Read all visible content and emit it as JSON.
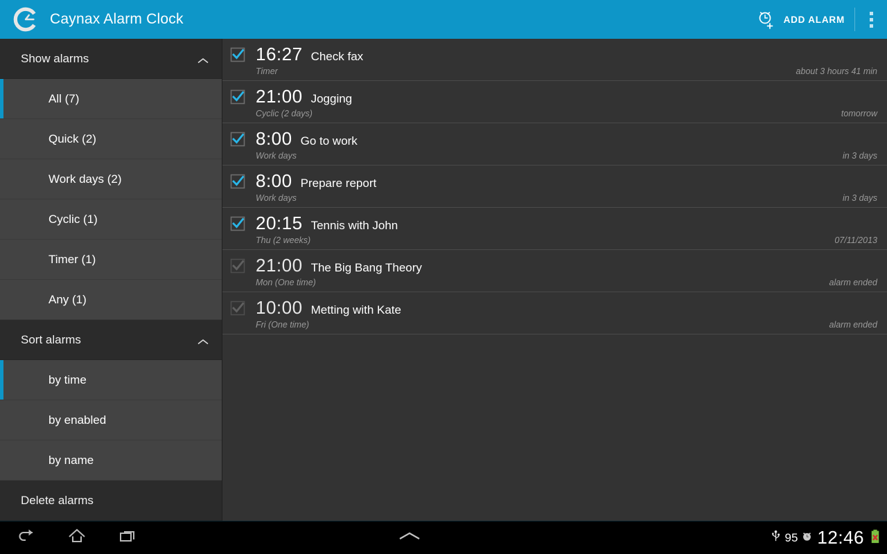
{
  "app": {
    "title": "Caynax Alarm Clock",
    "logo_icon": "caynax-c-clock-logo",
    "accent_color": "#0e96c8",
    "sidebar_bg": "#2b2b2b",
    "list_bg": "#333333"
  },
  "actionbar": {
    "add_alarm_label": "ADD ALARM",
    "add_alarm_icon": "alarm-add-icon",
    "overflow_icon": "overflow-menu-icon"
  },
  "sidebar": {
    "show_section": {
      "label": "Show alarms",
      "collapse_icon": "chevron-up-icon",
      "items": [
        {
          "label": "All (7)",
          "selected": true
        },
        {
          "label": "Quick (2)",
          "selected": false
        },
        {
          "label": "Work days (2)",
          "selected": false
        },
        {
          "label": "Cyclic (1)",
          "selected": false
        },
        {
          "label": "Timer (1)",
          "selected": false
        },
        {
          "label": "Any (1)",
          "selected": false
        }
      ]
    },
    "sort_section": {
      "label": "Sort alarms",
      "collapse_icon": "chevron-up-icon",
      "items": [
        {
          "label": "by time",
          "selected": true
        },
        {
          "label": "by enabled",
          "selected": false
        },
        {
          "label": "by name",
          "selected": false
        }
      ]
    },
    "delete_label": "Delete alarms"
  },
  "alarms": [
    {
      "time": "16:27",
      "name": "Check fax",
      "type": "Timer",
      "status": "about 3 hours 41 min",
      "enabled": true
    },
    {
      "time": "21:00",
      "name": "Jogging",
      "type": "Cyclic (2 days)",
      "status": "tomorrow",
      "enabled": true
    },
    {
      "time": "8:00",
      "name": "Go to work",
      "type": "Work days",
      "status": "in 3 days",
      "enabled": true
    },
    {
      "time": "8:00",
      "name": "Prepare report",
      "type": "Work days",
      "status": "in 3 days",
      "enabled": true
    },
    {
      "time": "20:15",
      "name": "Tennis with John",
      "type": "Thu (2 weeks)",
      "status": "07/11/2013",
      "enabled": true
    },
    {
      "time": "21:00",
      "name": "The Big Bang Theory",
      "type": "Mon (One time)",
      "status": "alarm ended",
      "enabled": false
    },
    {
      "time": "10:00",
      "name": "Metting with Kate",
      "type": "Fri (One time)",
      "status": "alarm ended",
      "enabled": false
    }
  ],
  "systembar": {
    "back_icon": "back-icon",
    "home_icon": "home-icon",
    "recents_icon": "recent-apps-icon",
    "handle_icon": "chevron-up-icon",
    "usb_icon": "usb-icon",
    "battery_percent": "95",
    "alarm_set_icon": "alarm-clock-icon",
    "clock": "12:46",
    "battery_icon": "battery-error-icon"
  }
}
